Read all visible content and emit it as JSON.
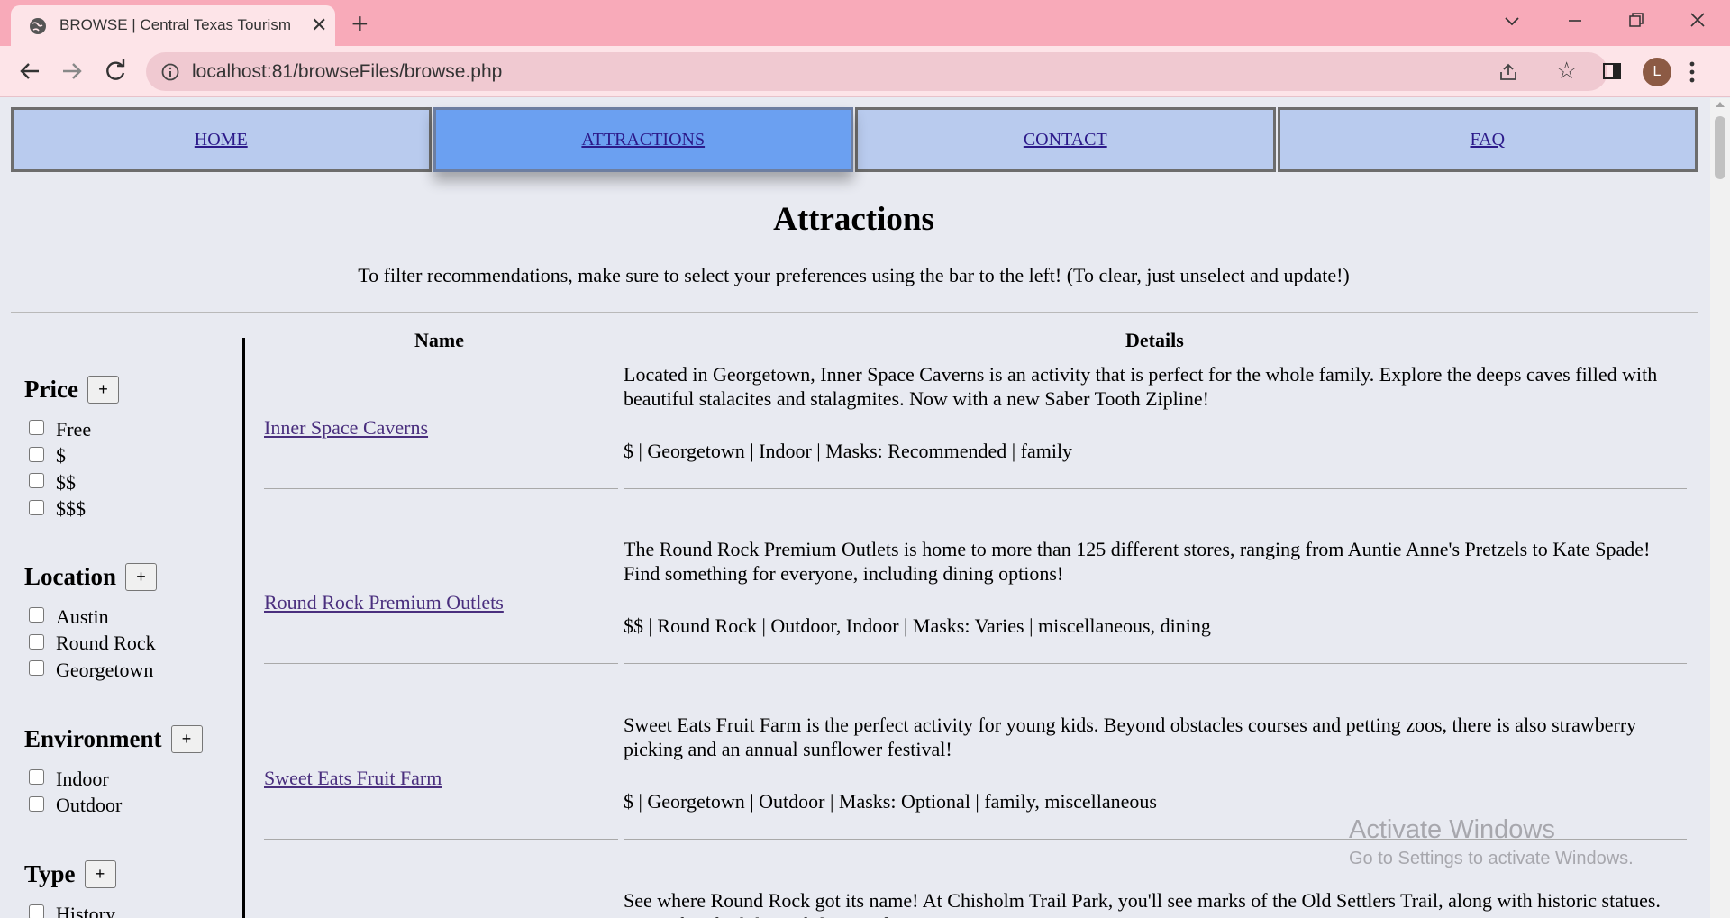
{
  "browser": {
    "tab_title": "BROWSE | Central Texas Tourism",
    "new_tab_label": "+",
    "url": "localhost:81/browseFiles/browse.php",
    "avatar_letter": "L"
  },
  "nav": {
    "items": [
      {
        "label": "HOME",
        "active": false
      },
      {
        "label": "ATTRACTIONS",
        "active": true
      },
      {
        "label": "CONTACT",
        "active": false
      },
      {
        "label": "FAQ",
        "active": false
      }
    ]
  },
  "page": {
    "title": "Attractions",
    "intro": "To filter recommendations, make sure to select your preferences using the bar to the left! (To clear, just unselect and update!)"
  },
  "filters": {
    "toggle_label": "+",
    "groups": [
      {
        "heading": "Price",
        "options": [
          "Free",
          "$",
          "$$",
          "$$$"
        ]
      },
      {
        "heading": "Location",
        "options": [
          "Austin",
          "Round Rock",
          "Georgetown"
        ]
      },
      {
        "heading": "Environment",
        "options": [
          "Indoor",
          "Outdoor"
        ]
      },
      {
        "heading": "Type",
        "options": [
          "History"
        ]
      }
    ]
  },
  "table": {
    "headers": {
      "name": "Name",
      "details": "Details"
    },
    "rows": [
      {
        "name": "Inner Space Caverns",
        "desc": "Located in Georgetown, Inner Space Caverns is an activity that is perfect for the whole family. Explore the deeps caves filled with beautiful stalacites and stalagmites. Now with a new Saber Tooth Zipline!",
        "meta": "$ | Georgetown | Indoor | Masks: Recommended | family"
      },
      {
        "name": "Round Rock Premium Outlets",
        "desc": "The Round Rock Premium Outlets is home to more than 125 different stores, ranging from Auntie Anne's Pretzels to Kate Spade! Find something for everyone, including dining options!",
        "meta": "$$ | Round Rock | Outdoor, Indoor | Masks: Varies | miscellaneous, dining"
      },
      {
        "name": "Sweet Eats Fruit Farm",
        "desc": "Sweet Eats Fruit Farm is the perfect activity for young kids. Beyond obstacles courses and petting zoos, there is also strawberry picking and an annual sunflower festival!",
        "meta": "$ | Georgetown | Outdoor | Masks: Optional | family, miscellaneous"
      },
      {
        "name": "",
        "desc": "See where Round Rock got its name! At Chisholm Trail Park, you'll see marks of the Old Settlers Trail, along with historic statues. It's perfect for hiking, fishing and picnics!",
        "meta": ""
      }
    ]
  },
  "watermark": {
    "line1": "Activate Windows",
    "line2": "Go to Settings to activate Windows."
  }
}
